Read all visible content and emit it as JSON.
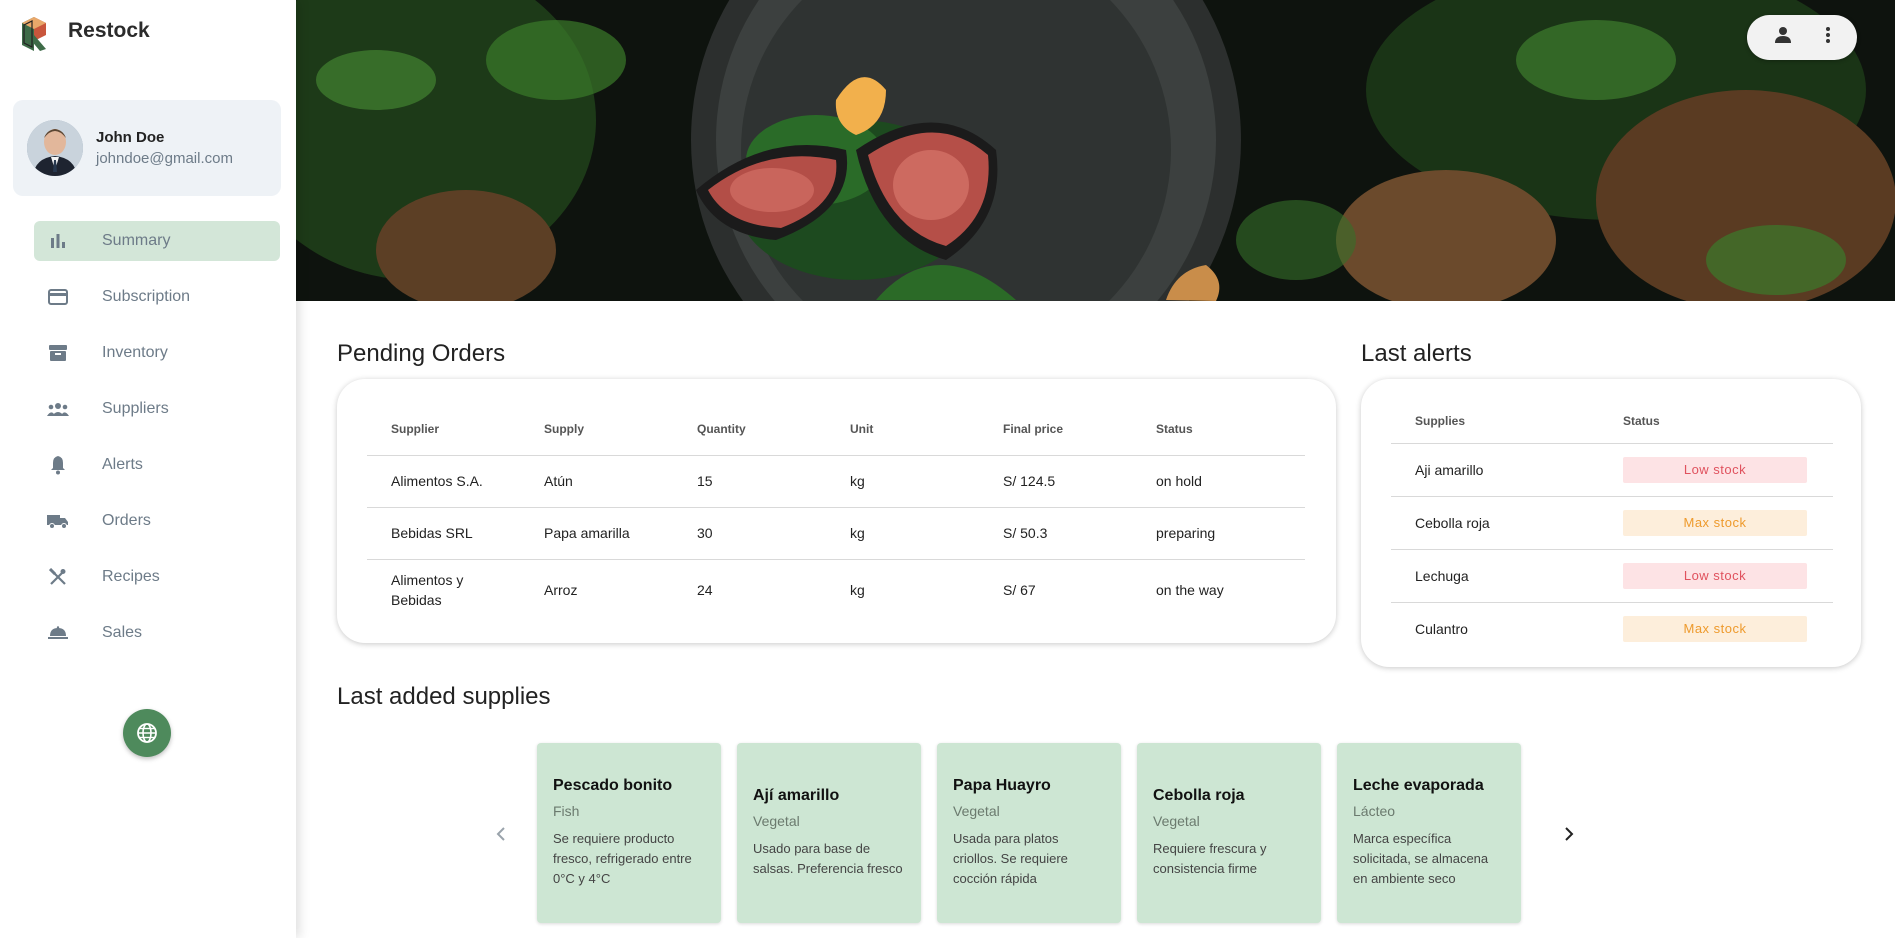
{
  "app": {
    "name": "Restock"
  },
  "user": {
    "name": "John Doe",
    "email": "johndoe@gmail.com"
  },
  "nav": {
    "items": [
      {
        "label": "Summary",
        "icon": "bar-chart-icon",
        "active": true
      },
      {
        "label": "Subscription",
        "icon": "credit-card-icon",
        "active": false
      },
      {
        "label": "Inventory",
        "icon": "archive-icon",
        "active": false
      },
      {
        "label": "Suppliers",
        "icon": "people-icon",
        "active": false
      },
      {
        "label": "Alerts",
        "icon": "bell-icon",
        "active": false
      },
      {
        "label": "Orders",
        "icon": "truck-icon",
        "active": false
      },
      {
        "label": "Recipes",
        "icon": "utensils-icon",
        "active": false
      },
      {
        "label": "Sales",
        "icon": "cloche-icon",
        "active": false
      }
    ]
  },
  "pending_orders": {
    "title": "Pending Orders",
    "headers": [
      "Supplier",
      "Supply",
      "Quantity",
      "Unit",
      "Final price",
      "Status"
    ],
    "rows": [
      [
        "Alimentos S.A.",
        "Atún",
        "15",
        "kg",
        "S/ 124.5",
        "on hold"
      ],
      [
        "Bebidas SRL",
        "Papa amarilla",
        "30",
        "kg",
        "S/ 50.3",
        "preparing"
      ],
      [
        "Alimentos y Bebidas",
        "Arroz",
        "24",
        "kg",
        "S/ 67",
        "on the way"
      ]
    ]
  },
  "last_alerts": {
    "title": "Last alerts",
    "headers": [
      "Supplies",
      "Status"
    ],
    "rows": [
      {
        "supply": "Aji amarillo",
        "status": "Low stock",
        "kind": "low"
      },
      {
        "supply": "Cebolla roja",
        "status": "Max stock",
        "kind": "max"
      },
      {
        "supply": "Lechuga",
        "status": "Low stock",
        "kind": "low"
      },
      {
        "supply": "Culantro",
        "status": "Max stock",
        "kind": "max"
      }
    ]
  },
  "last_supplies": {
    "title": "Last added supplies",
    "cards": [
      {
        "name": "Pescado bonito",
        "category": "Fish",
        "description": "Se requiere producto fresco, refrigerado entre 0°C y 4°C"
      },
      {
        "name": "Ají amarillo",
        "category": "Vegetal",
        "description": "Usado para base de salsas. Preferencia fresco"
      },
      {
        "name": "Papa Huayro",
        "category": "Vegetal",
        "description": "Usada para platos criollos. Se requiere cocción rápida"
      },
      {
        "name": "Cebolla roja",
        "category": "Vegetal",
        "description": "Requiere frescura y consistencia firme"
      },
      {
        "name": "Leche evaporada",
        "category": "Lácteo",
        "description": "Marca específica solicitada, se almacena en ambiente seco"
      }
    ]
  },
  "colors": {
    "accent_green": "#4e8a5c",
    "active_nav_bg": "#d3e6d8",
    "card_green": "#cde6d3",
    "low_stock": "#e0525e",
    "max_stock": "#ee9a2c"
  }
}
